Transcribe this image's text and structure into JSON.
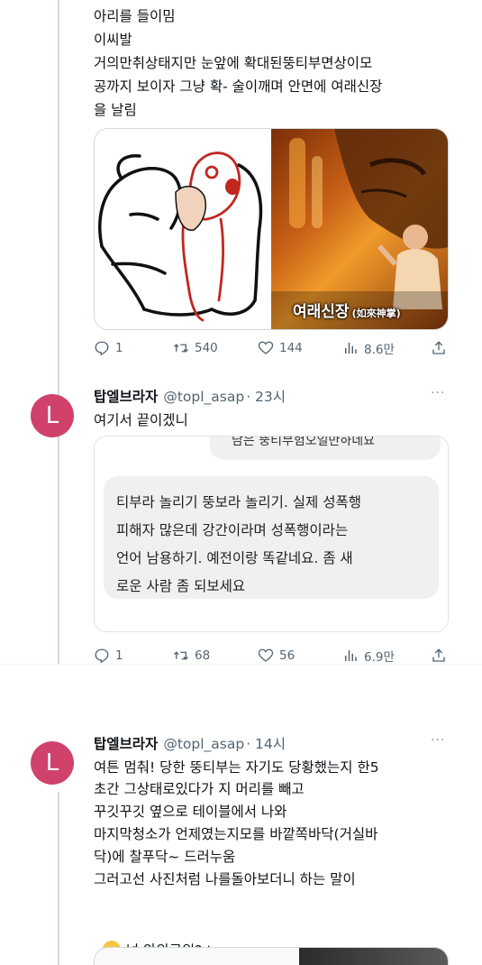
{
  "tweet1": {
    "text_lines": [
      "아리를 들이밈",
      "이씨발",
      "거의만취상태지만 눈앞에 확대된뚱티부면상이모",
      "공까지 보이자 그냥 확- 술이깨며 안면에 여래신장",
      "을 날림"
    ],
    "media_caption": "여래신장",
    "media_caption_sub": "(如來神掌)",
    "replies": "1",
    "retweets": "540",
    "likes": "144",
    "views": "8.6만"
  },
  "tweet2": {
    "avatar_letter": "L",
    "name": "탑엘브라자",
    "handle": "@topl_asap",
    "time": "· 23시",
    "more": "···",
    "text": "여기서 끝이겠니",
    "quote_top": "남은 뚱티부험오일만하네요",
    "quote_lines": [
      "티부라 놀리기 뚱보라 놀리기. 실제 성폭행",
      "피해자 많은데 강간이라며 성폭행이라는",
      "언어 남용하기. 예전이랑 똑같네요. 좀 새",
      "로운 사람 좀 되보세요"
    ],
    "replies": "1",
    "retweets": "68",
    "likes": "56",
    "views": "6.9만"
  },
  "tweet3": {
    "avatar_letter": "L",
    "name": "탑엘브라자",
    "handle": "@topl_asap",
    "time": "· 14시",
    "more": "···",
    "text_lines": [
      "여튼 멈춰! 당한 뚱티부는 자기도 당황했는지 한5",
      "초간 그상태로있다가 지 머리를 빼고",
      "꾸깃꾸깃 옆으로 테이블에서 나와",
      "마지막청소가 언제였는지모를 바깥쪽바닥(거실바",
      "닥)에 찰푸닥~ 드러누움",
      "그러고선 사진처럼 나를돌아보더니 하는 말이"
    ],
    "emoji_line": "넌 안외로워?ㅎ"
  },
  "colors": {
    "accent_avatar": "#d0426b",
    "muted": "#536471",
    "thread_line": "#cfd9de"
  }
}
